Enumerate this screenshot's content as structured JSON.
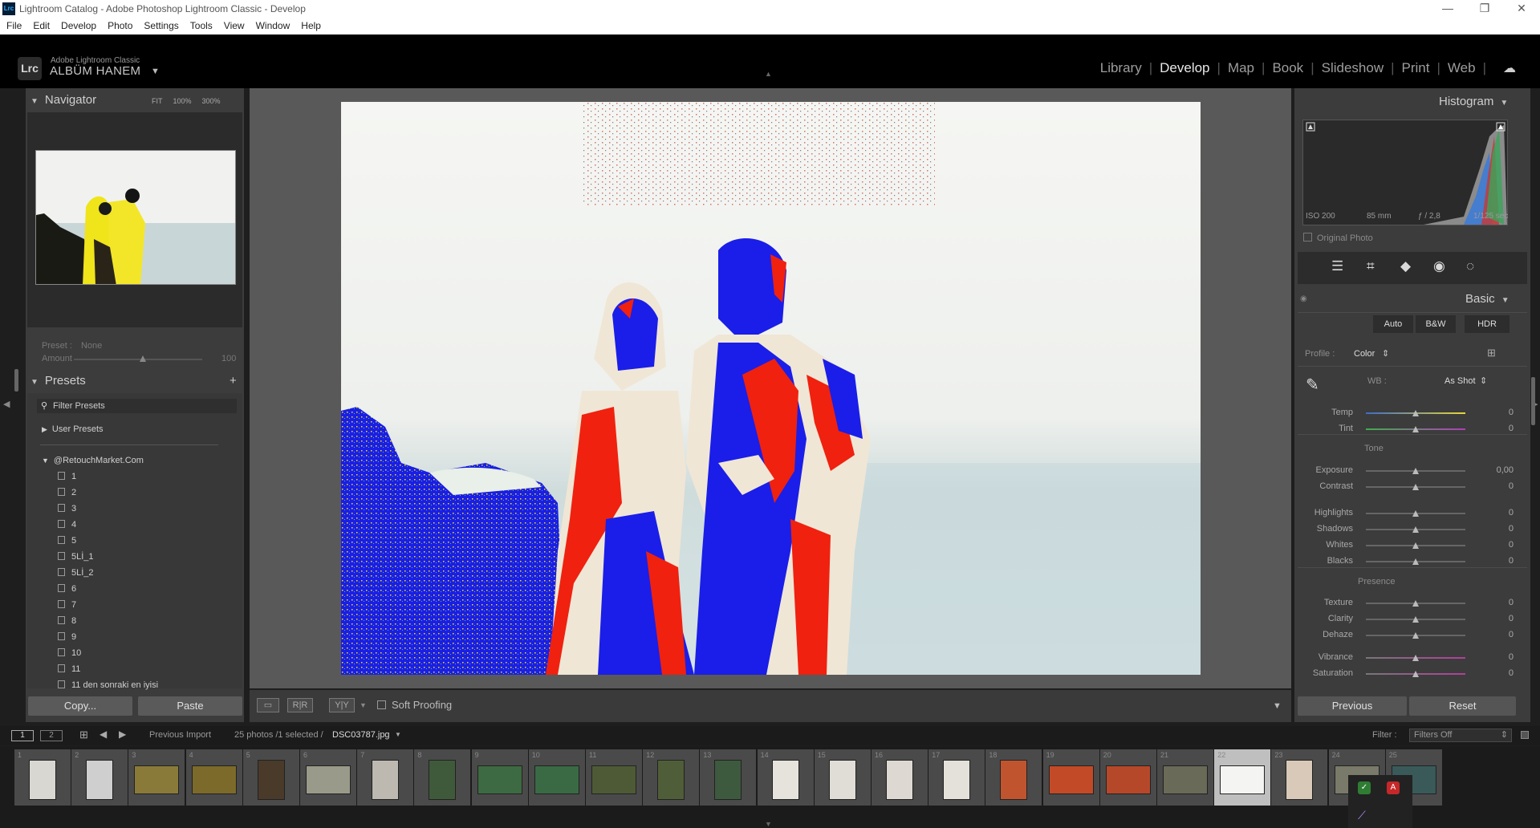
{
  "window": {
    "title": "Lightroom Catalog - Adobe Photoshop Lightroom Classic - Develop",
    "app_icon": "Lrc",
    "controls": [
      "minimize",
      "maximize",
      "close"
    ]
  },
  "menu": [
    "File",
    "Edit",
    "Develop",
    "Photo",
    "Settings",
    "Tools",
    "View",
    "Window",
    "Help"
  ],
  "identity": {
    "badge": "Lrc",
    "small": "Adobe Lightroom Classic",
    "name": "ALBÜM HANEM"
  },
  "modules": {
    "items": [
      "Library",
      "Develop",
      "Map",
      "Book",
      "Slideshow",
      "Print",
      "Web"
    ],
    "active": "Develop"
  },
  "navigator": {
    "title": "Navigator",
    "zoom": [
      "FIT",
      "100%",
      "300%"
    ]
  },
  "preset_amount": {
    "preset_label": "Preset :",
    "preset_value": "None",
    "amount_label": "Amount",
    "amount_value": "100",
    "amount_fraction": 0.55
  },
  "presets": {
    "title": "Presets",
    "filter": "Filter Presets",
    "groups": [
      {
        "label": "User Presets",
        "expanded": false
      },
      {
        "label": "@RetouchMarket.Com",
        "expanded": true
      }
    ],
    "items": [
      "1",
      "2",
      "3",
      "4",
      "5",
      "5Lİ_1",
      "5Lİ_2",
      "6",
      "7",
      "8",
      "9",
      "10",
      "11",
      "11 den sonraki en iyisi"
    ]
  },
  "left_buttons": {
    "copy": "Copy...",
    "paste": "Paste"
  },
  "toolbar": {
    "soft_proofing": "Soft Proofing"
  },
  "histogram": {
    "title": "Histogram",
    "iso": "ISO 200",
    "focal": "85 mm",
    "aperture": "ƒ / 2,8",
    "shutter": "1/125 sec",
    "original_photo": "Original Photo"
  },
  "basic": {
    "title": "Basic",
    "auto": "Auto",
    "bw": "B&W",
    "hdr": "HDR",
    "profile_label": "Profile :",
    "profile_value": "Color",
    "wb_label": "WB :",
    "wb_value": "As Shot",
    "tone_label": "Tone",
    "presence_label": "Presence",
    "sliders": [
      {
        "label": "Temp",
        "value": "0"
      },
      {
        "label": "Tint",
        "value": "0"
      },
      {
        "label": "Exposure",
        "value": "0,00"
      },
      {
        "label": "Contrast",
        "value": "0"
      },
      {
        "label": "Highlights",
        "value": "0"
      },
      {
        "label": "Shadows",
        "value": "0"
      },
      {
        "label": "Whites",
        "value": "0"
      },
      {
        "label": "Blacks",
        "value": "0"
      },
      {
        "label": "Texture",
        "value": "0"
      },
      {
        "label": "Clarity",
        "value": "0"
      },
      {
        "label": "Dehaze",
        "value": "0"
      },
      {
        "label": "Vibrance",
        "value": "0"
      },
      {
        "label": "Saturation",
        "value": "0"
      }
    ]
  },
  "right_buttons": {
    "previous": "Previous",
    "reset": "Reset"
  },
  "filmstrip_bar": {
    "view1": "1",
    "view2": "2",
    "source": "Previous Import",
    "count": "25 photos /1 selected /",
    "filename": "DSC03787.jpg",
    "filter_label": "Filter :",
    "filter_value": "Filters Off"
  },
  "filmstrip": {
    "selected": 22,
    "cells": [
      "1",
      "2",
      "3",
      "4",
      "5",
      "6",
      "7",
      "8",
      "9",
      "10",
      "11",
      "12",
      "13",
      "14",
      "15",
      "16",
      "17",
      "18",
      "19",
      "20",
      "21",
      "22",
      "23",
      "24",
      "25"
    ]
  },
  "colors": {
    "panel": "#3c3c3c",
    "center": "#595959",
    "mask_blue": "#1a1ee8",
    "mask_red": "#f0210f",
    "mask_yellow": "#f5e400"
  }
}
